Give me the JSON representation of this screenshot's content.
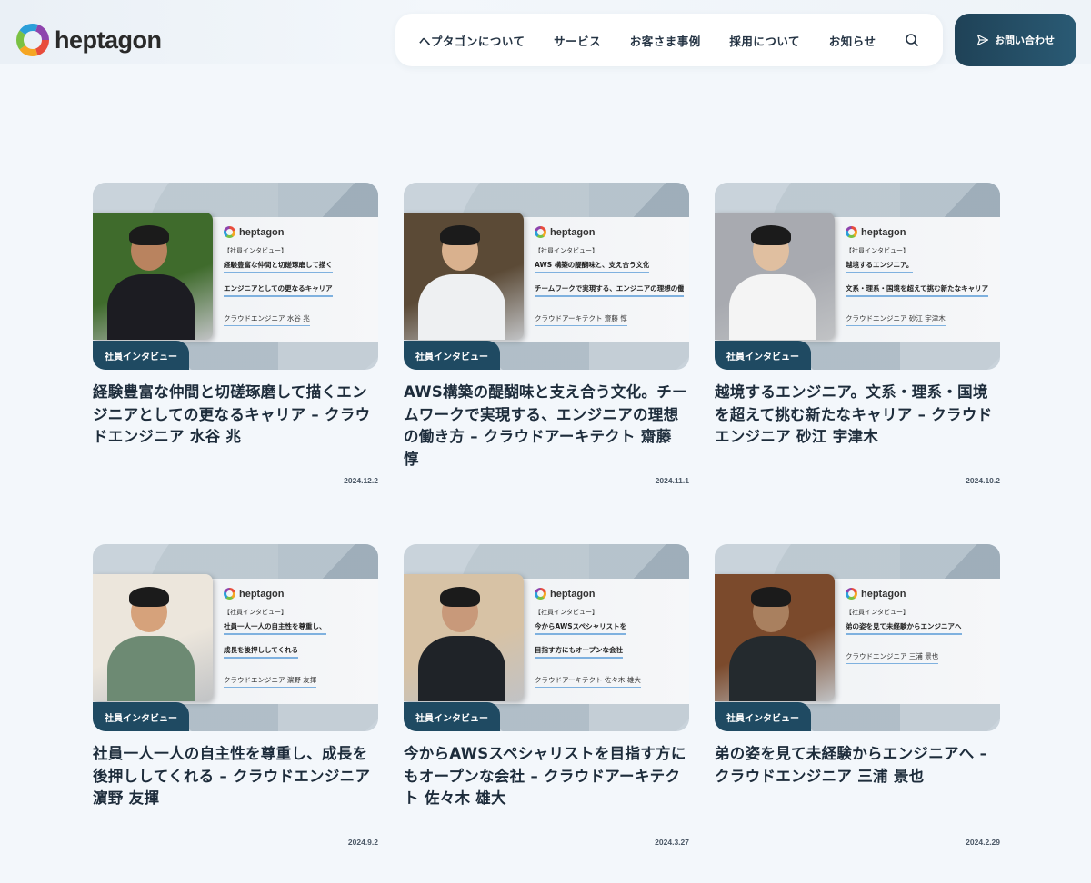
{
  "site": {
    "logo_text": "heptagon"
  },
  "nav": {
    "items": [
      "ヘプタゴンについて",
      "サービス",
      "お客さま事例",
      "採用について",
      "お知らせ"
    ],
    "search_icon": "search-icon",
    "contact_label": "お問い合わせ"
  },
  "cards": [
    {
      "badge": "社員インタビュー",
      "thumb_logo": "heptagon",
      "thumb_tag": "【社員インタビュー】",
      "thumb_line1": "経験豊富な仲間と切磋琢磨して描く",
      "thumb_line2": "エンジニアとしての更なるキャリア",
      "thumb_name": "クラウドエンジニア 水谷 兆",
      "title": "経験豊富な仲間と切磋琢磨して描くエンジニアとしての更なるキャリア – クラウドエンジニア 水谷 兆",
      "date": "2024.12.2",
      "photo_bg": "#3f6b2c",
      "photo_fg": "#1c1c22",
      "skin": "#b9835f"
    },
    {
      "badge": "社員インタビュー",
      "thumb_logo": "heptagon",
      "thumb_tag": "【社員インタビュー】",
      "thumb_line1": "AWS 構築の醍醐味と、支え合う文化",
      "thumb_line2": "チームワークで実現する、エンジニアの理想の働",
      "thumb_name": "クラウドアーキテクト 齋藤 惇",
      "title": "AWS構築の醍醐味と支え合う文化。チームワークで実現する、エンジニアの理想の働き方 – クラウドアーキテクト 齋藤 惇",
      "date": "2024.11.1",
      "photo_bg": "#5b4a36",
      "photo_fg": "#eef0f2",
      "skin": "#d9b18e"
    },
    {
      "badge": "社員インタビュー",
      "thumb_logo": "heptagon",
      "thumb_tag": "【社員インタビュー】",
      "thumb_line1": "越境するエンジニア。",
      "thumb_line2": "文系・理系・国境を超えて挑む新たなキャリア",
      "thumb_name": "クラウドエンジニア 砂江 宇津木",
      "title": "越境するエンジニア。文系・理系・国境を超えて挑む新たなキャリア – クラウドエンジニア 砂江 宇津木",
      "date": "2024.10.2",
      "photo_bg": "#a8aab0",
      "photo_fg": "#f4f4f4",
      "skin": "#e0bfa0"
    },
    {
      "badge": "社員インタビュー",
      "thumb_logo": "heptagon",
      "thumb_tag": "【社員インタビュー】",
      "thumb_line1": "社員一人一人の自主性を尊重し、",
      "thumb_line2": "成長を後押ししてくれる",
      "thumb_name": "クラウドエンジニア 濵野 友揮",
      "title": "社員一人一人の自主性を尊重し、成長を後押ししてくれる – クラウドエンジニア 濵野 友揮",
      "date": "2024.9.2",
      "photo_bg": "#ece6dc",
      "photo_fg": "#6d8a73",
      "skin": "#d6a27b"
    },
    {
      "badge": "社員インタビュー",
      "thumb_logo": "heptagon",
      "thumb_tag": "【社員インタビュー】",
      "thumb_line1": "今からAWSスペシャリストを",
      "thumb_line2": "目指す方にもオープンな会社",
      "thumb_name": "クラウドアーキテクト 佐々木 雄大",
      "title": "今からAWSスペシャリストを目指す方にもオープンな会社 – クラウドアーキテクト 佐々木 雄大",
      "date": "2024.3.27",
      "photo_bg": "#d7c2a5",
      "photo_fg": "#1f2328",
      "skin": "#c8997a"
    },
    {
      "badge": "社員インタビュー",
      "thumb_logo": "heptagon",
      "thumb_tag": "【社員インタビュー】",
      "thumb_line1": "弟の姿を見て未経験からエンジニアへ",
      "thumb_line2": "",
      "thumb_name": "クラウドエンジニア 三浦 景也",
      "title": "弟の姿を見て未経験からエンジニアへ – クラウドエンジニア 三浦 景也",
      "date": "2024.2.29",
      "photo_bg": "#7b4a2c",
      "photo_fg": "#242a2e",
      "skin": "#a9805f"
    }
  ]
}
